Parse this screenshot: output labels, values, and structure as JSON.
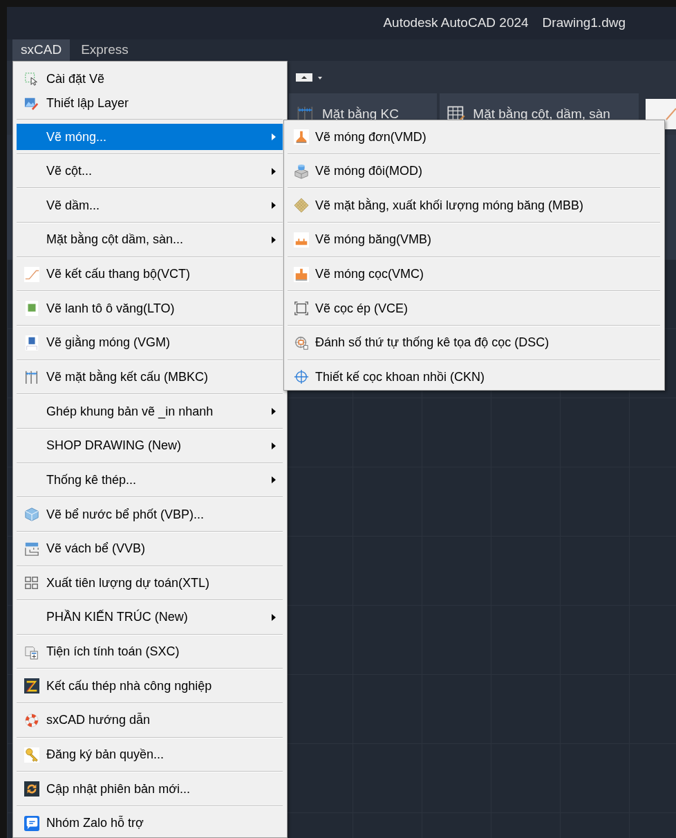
{
  "title_bar": {
    "app_title": "Autodesk AutoCAD 2024",
    "file_name": "Drawing1.dwg"
  },
  "menu_bar": [
    {
      "label": "sxCAD",
      "selected": true
    },
    {
      "label": "Express",
      "selected": false
    }
  ],
  "ribbon": {
    "buttons": [
      {
        "label": "Mặt bằng KC"
      },
      {
        "label": "Mặt bằng cột, dầm, sàn"
      }
    ]
  },
  "menu": {
    "quick_items": [
      {
        "label": "Cài đặt Vẽ"
      },
      {
        "label": "Thiết lập Layer"
      }
    ],
    "items": [
      {
        "label": "Vẽ móng...",
        "has_submenu": true,
        "selected": true
      },
      {
        "label": "Vẽ cột...",
        "has_submenu": true,
        "selected": false
      },
      {
        "label": "Vẽ dầm...",
        "has_submenu": true,
        "selected": false
      },
      {
        "label": "Mặt bằng cột dầm, sàn...",
        "has_submenu": true,
        "selected": false
      },
      {
        "label": "Vẽ kết cấu thang bộ(VCT)",
        "has_submenu": false,
        "selected": false
      },
      {
        "label": "Vẽ lanh tô ô văng(LTO)",
        "has_submenu": false,
        "selected": false
      },
      {
        "label": "Vẽ giằng móng (VGM)",
        "has_submenu": false,
        "selected": false
      },
      {
        "label": "Vẽ  mặt bằng kết cấu  (MBKC)",
        "has_submenu": false,
        "selected": false
      },
      {
        "label": "Ghép khung bản vẽ _in nhanh",
        "has_submenu": true,
        "selected": false
      },
      {
        "label": "SHOP DRAWING (New)",
        "has_submenu": true,
        "selected": false
      },
      {
        "label": "Thống kê thép...",
        "has_submenu": true,
        "selected": false
      },
      {
        "label": "Vẽ bể nước bể phốt (VBP)...",
        "has_submenu": false,
        "selected": false
      },
      {
        "label": "Vẽ vách bể (VVB)",
        "has_submenu": false,
        "selected": false
      },
      {
        "label": "Xuất tiên lượng dự toán(XTL)",
        "has_submenu": false,
        "selected": false
      },
      {
        "label": "PHẦN KIẾN TRÚC (New)",
        "has_submenu": true,
        "selected": false
      },
      {
        "label": "Tiện ích tính toán (SXC)",
        "has_submenu": false,
        "selected": false
      },
      {
        "label": "Kết cấu thép nhà công nghiệp",
        "has_submenu": false,
        "selected": false
      },
      {
        "label": "sxCAD hướng dẫn",
        "has_submenu": false,
        "selected": false
      },
      {
        "label": "Đăng ký bản quyền...",
        "has_submenu": false,
        "selected": false
      },
      {
        "label": "Cập nhật phiên bản mới...",
        "has_submenu": false,
        "selected": false
      },
      {
        "label": "Nhóm Zalo hỗ trợ",
        "has_submenu": false,
        "selected": false
      }
    ]
  },
  "submenu": {
    "items": [
      {
        "label": "Vẽ móng đơn(VMD)",
        "selected": false
      },
      {
        "label": "Vẽ móng đôi(MOD)",
        "selected": false
      },
      {
        "label": "Vẽ mặt bằng, xuất khối lượng móng băng (MBB)",
        "selected": false
      },
      {
        "label": "Vẽ móng băng(VMB)",
        "selected": false
      },
      {
        "label": "Vẽ móng cọc(VMC)",
        "selected": false
      },
      {
        "label": "Vẽ cọc ép (VCE)",
        "selected": false
      },
      {
        "label": "Đánh số thứ tự thống kê tọa độ cọc (DSC)",
        "selected": false
      },
      {
        "label": "Thiết kế cọc khoan nhồi (CKN)",
        "selected": false
      }
    ]
  }
}
